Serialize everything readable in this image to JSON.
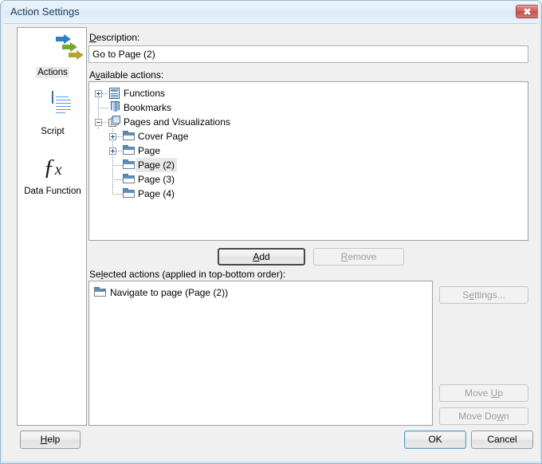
{
  "window": {
    "title": "Action Settings",
    "close_icon": "close-icon",
    "close_glyph": "✖"
  },
  "sidebar": {
    "items": [
      {
        "label": "Actions",
        "icon": "actions-arrows-icon",
        "selected": true
      },
      {
        "label": "Script",
        "icon": "script-document-icon",
        "selected": false
      },
      {
        "label": "Data Function",
        "icon": "fx-function-icon",
        "selected": false
      }
    ]
  },
  "description": {
    "label": "Description:",
    "label_accel": "D",
    "value": "Go to Page (2)"
  },
  "available": {
    "label_pre": "A",
    "label_accel": "v",
    "label_post": "ailable actions:",
    "label_full": "Available actions:",
    "tree": [
      {
        "label": "Functions",
        "icon": "functions-icon",
        "expander": "plus",
        "level": 0,
        "selected": false
      },
      {
        "label": "Bookmarks",
        "icon": "bookmark-icon",
        "expander": "none",
        "level": 0,
        "selected": false
      },
      {
        "label": "Pages and Visualizations",
        "icon": "pages-icon",
        "expander": "minus",
        "level": 0,
        "selected": false
      },
      {
        "label": "Cover Page",
        "icon": "folder-icon",
        "expander": "plus",
        "level": 1,
        "selected": false
      },
      {
        "label": "Page",
        "icon": "folder-icon",
        "expander": "plus",
        "level": 1,
        "selected": false
      },
      {
        "label": "Page (2)",
        "icon": "folder-icon",
        "expander": "none",
        "level": 1,
        "selected": true
      },
      {
        "label": "Page (3)",
        "icon": "folder-icon",
        "expander": "none",
        "level": 1,
        "selected": false
      },
      {
        "label": "Page (4)",
        "icon": "folder-icon",
        "expander": "none",
        "level": 1,
        "selected": false
      }
    ]
  },
  "middle_buttons": {
    "add": {
      "label_pre": "",
      "accel": "A",
      "label_post": "dd",
      "label_full": "Add",
      "enabled": true
    },
    "remove": {
      "label_pre": "",
      "accel": "R",
      "label_post": "emove",
      "label_full": "Remove",
      "enabled": false
    }
  },
  "selected_actions": {
    "label_pre": "Se",
    "label_accel": "l",
    "label_post": "ected actions (applied in top-bottom order):",
    "label_full": "Selected actions (applied in top-bottom order):",
    "rows": [
      {
        "label": "Navigate to page (Page (2))",
        "icon": "folder-icon"
      }
    ]
  },
  "side_buttons": {
    "settings": {
      "label_pre": "S",
      "accel": "e",
      "label_post": "ttings...",
      "label_full": "Settings...",
      "enabled": false
    },
    "move_up": {
      "label_pre": "Move ",
      "accel": "U",
      "label_post": "p",
      "label_full": "Move Up",
      "enabled": false
    },
    "move_down": {
      "label_pre": "Move Do",
      "accel": "w",
      "label_post": "n",
      "label_full": "Move Down",
      "enabled": false
    }
  },
  "footer": {
    "help": {
      "label_pre": "",
      "accel": "H",
      "label_post": "elp",
      "label_full": "Help",
      "enabled": true
    },
    "ok": {
      "label_full": "OK",
      "enabled": true,
      "is_default": true
    },
    "cancel": {
      "label_full": "Cancel",
      "enabled": true
    }
  },
  "colors": {
    "title_text": "#1f3b57",
    "dialog_bg": "#f0f0f0",
    "field_bg": "#ffffff",
    "accent_blue": "#2f7fc8",
    "accent_green": "#74a832",
    "accent_olive": "#b9a32f",
    "close_red": "#c44c4a",
    "default_button_border": "#5a9ec4",
    "selection_gray": "#e8e8e8"
  }
}
